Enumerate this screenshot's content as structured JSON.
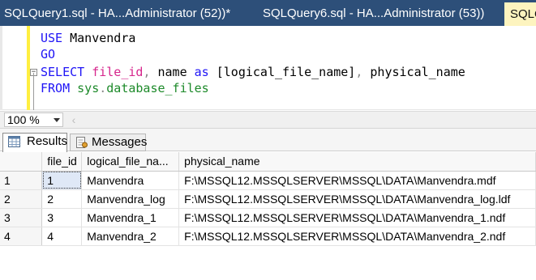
{
  "tabs": [
    {
      "label": "SQLQuery1.sql - HA...Administrator (52))*"
    },
    {
      "label": "SQLQuery6.sql - HA...Administrator (53))"
    },
    {
      "label": "SQLQ"
    }
  ],
  "editor": {
    "lines": [
      [
        {
          "t": "USE ",
          "c": "kw"
        },
        {
          "t": "Manvendra",
          "c": "id"
        }
      ],
      [
        {
          "t": "GO",
          "c": "kw"
        }
      ],
      [
        {
          "t": "SELECT ",
          "c": "kw"
        },
        {
          "t": "file_id",
          "c": "fn"
        },
        {
          "t": ", ",
          "c": "gr"
        },
        {
          "t": "name ",
          "c": "id"
        },
        {
          "t": "as ",
          "c": "kw"
        },
        {
          "t": "[logical_file_name]",
          "c": "id"
        },
        {
          "t": ", ",
          "c": "gr"
        },
        {
          "t": "physical_name",
          "c": "id"
        }
      ],
      [
        {
          "t": "FROM ",
          "c": "kw"
        },
        {
          "t": "sys",
          "c": "sy"
        },
        {
          "t": ".",
          "c": "gr"
        },
        {
          "t": "database_files",
          "c": "sy"
        }
      ]
    ]
  },
  "zoom": {
    "value": "100 %"
  },
  "result_tabs": {
    "results_label": "Results",
    "messages_label": "Messages"
  },
  "grid": {
    "columns": [
      "file_id",
      "logical_file_na...",
      "physical_name"
    ],
    "rows": [
      {
        "num": "1",
        "cells": [
          "1",
          "Manvendra",
          "F:\\MSSQL12.MSSQLSERVER\\MSSQL\\DATA\\Manvendra.mdf"
        ]
      },
      {
        "num": "2",
        "cells": [
          "2",
          "Manvendra_log",
          "F:\\MSSQL12.MSSQLSERVER\\MSSQL\\DATA\\Manvendra_log.ldf"
        ]
      },
      {
        "num": "3",
        "cells": [
          "3",
          "Manvendra_1",
          "F:\\MSSQL12.MSSQLSERVER\\MSSQL\\DATA\\Manvendra_1.ndf"
        ]
      },
      {
        "num": "4",
        "cells": [
          "4",
          "Manvendra_2",
          "F:\\MSSQL12.MSSQLSERVER\\MSSQL\\DATA\\Manvendra_2.ndf"
        ]
      }
    ]
  },
  "colors": {
    "tabstrip": "#2d4f79",
    "active_tab": "#fdf4bf",
    "keyword": "#1f14f6",
    "function": "#d6268c",
    "system_object": "#1d8a2a"
  }
}
